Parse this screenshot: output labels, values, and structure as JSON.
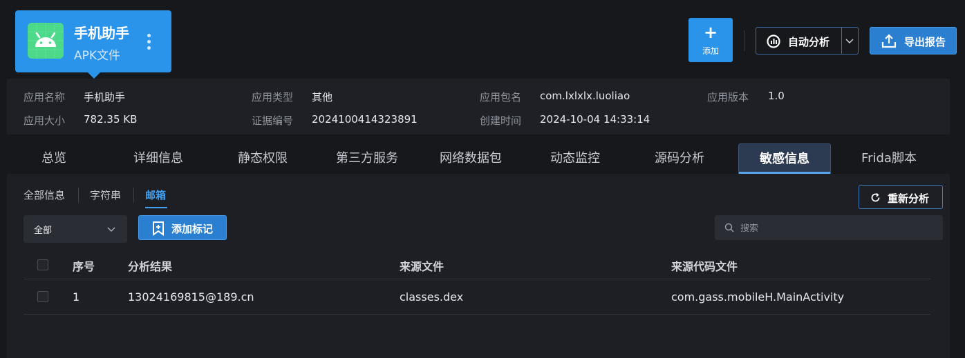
{
  "app": {
    "name": "手机助手",
    "type": "APK文件",
    "logo_icon": "android-robot-icon",
    "more_icon": "more-vertical-icon"
  },
  "toolbar": {
    "add_plus": "+",
    "add_label": "添加",
    "auto_label": "自动分析",
    "export_label": "导出报告"
  },
  "info": {
    "app_name_key": "应用名称",
    "app_name_val": "手机助手",
    "app_type_key": "应用类型",
    "app_type_val": "其他",
    "package_key": "应用包名",
    "package_val": "com.lxlxlx.luoliao",
    "version_key": "应用版本",
    "version_val": "1.0",
    "size_key": "应用大小",
    "size_val": "782.35 KB",
    "evidence_key": "证据编号",
    "evidence_val": "2024100414323891",
    "created_key": "创建时间",
    "created_val": "2024-10-04 14:33:14"
  },
  "tabs": [
    {
      "label": "总览"
    },
    {
      "label": "详细信息"
    },
    {
      "label": "静态权限"
    },
    {
      "label": "第三方服务"
    },
    {
      "label": "网络数据包"
    },
    {
      "label": "动态监控"
    },
    {
      "label": "源码分析"
    },
    {
      "label": "敏感信息",
      "active": true
    },
    {
      "label": "Frida脚本"
    }
  ],
  "subtabs": [
    {
      "label": "全部信息"
    },
    {
      "label": "字符串"
    },
    {
      "label": "邮箱",
      "active": true
    }
  ],
  "reanalyze_label": "重新分析",
  "filter": {
    "selected": "全部"
  },
  "mark_label": "添加标记",
  "search": {
    "placeholder": "搜索"
  },
  "table": {
    "headers": [
      "序号",
      "分析结果",
      "来源文件",
      "来源代码文件"
    ],
    "rows": [
      [
        "1",
        "13024169815@189.cn",
        "classes.dex",
        "com.gass.mobileH.MainActivity"
      ]
    ]
  },
  "colors": {
    "accent": "#2a93ea",
    "background": "#17181c",
    "panel": "#1e1f24",
    "active_subtab": "#3fa0f2"
  }
}
